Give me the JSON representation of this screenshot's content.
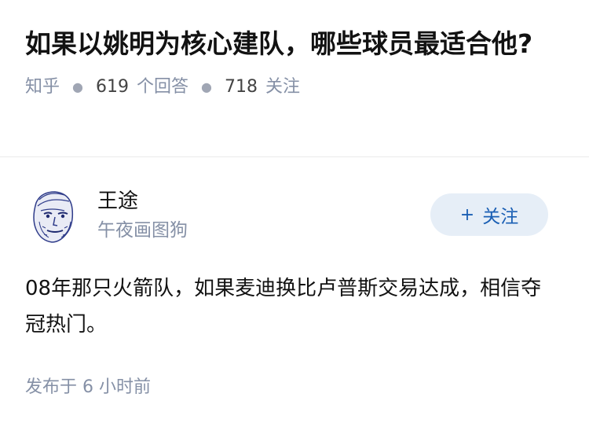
{
  "question": {
    "title": "如果以姚明为核心建队，哪些球员最适合他?",
    "source": "知乎",
    "answers_count": "619",
    "answers_label": "个回答",
    "followers_count": "718",
    "followers_label": "关注"
  },
  "answer": {
    "author_name": "王途",
    "author_bio": "午夜画图狗",
    "follow_label": "关注",
    "follow_icon": "plus-icon",
    "content": "08年那只火箭队，如果麦迪换比卢普斯交易达成，相信夺冠热门。",
    "published": "发布于  6 小时前"
  },
  "colors": {
    "meta": "#8590a6",
    "follow_bg": "#e6eef7",
    "follow_text": "#1a5fb4"
  }
}
